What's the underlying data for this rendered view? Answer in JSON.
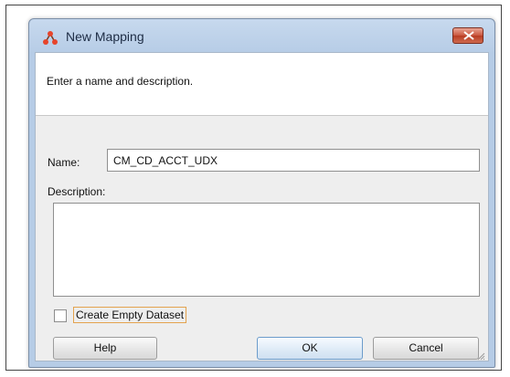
{
  "window": {
    "title": "New Mapping",
    "close_icon": "close-icon",
    "app_icon": "mapping-icon"
  },
  "header": {
    "instruction": "Enter a name and description."
  },
  "form": {
    "name_label": "Name:",
    "name_value": "CM_CD_ACCT_UDX",
    "description_label": "Description:",
    "description_value": "",
    "checkbox_label": "Create Empty Dataset",
    "checkbox_checked": false
  },
  "buttons": {
    "help": "Help",
    "ok": "OK",
    "cancel": "Cancel"
  },
  "colors": {
    "titlebar": "#b6cce6",
    "close_button": "#c9553d",
    "focus_outline": "#e3a24e"
  }
}
